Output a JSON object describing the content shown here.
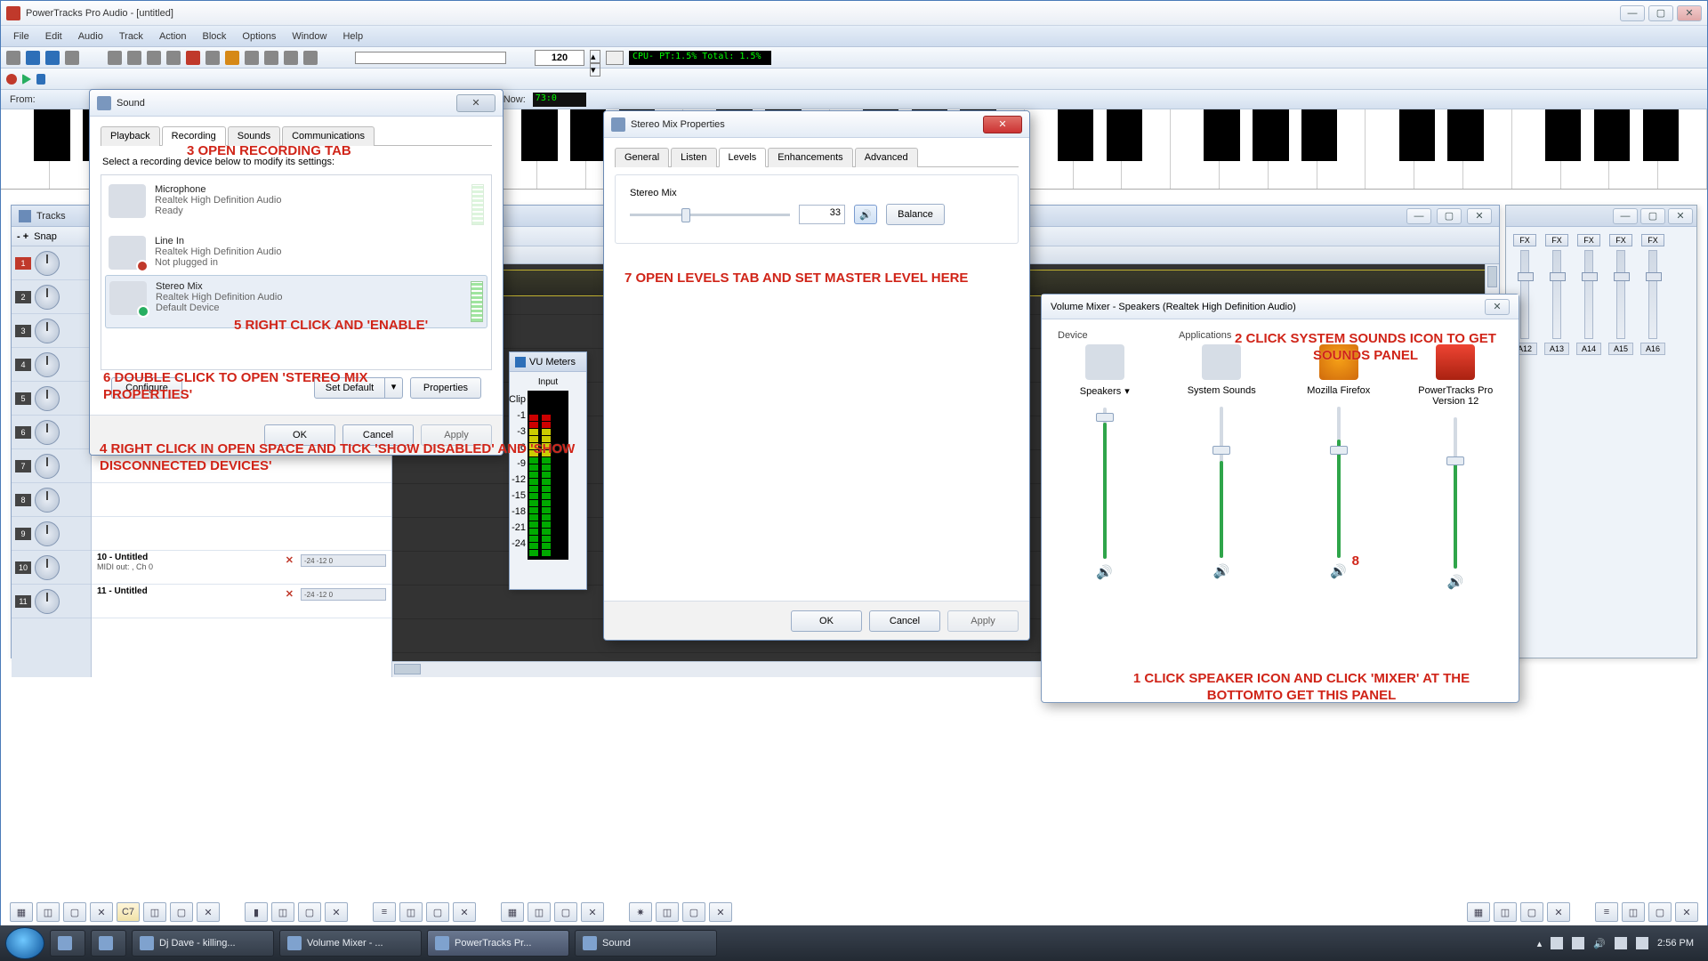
{
  "app": {
    "title": "PowerTracks Pro Audio - [untitled]"
  },
  "menu": [
    "File",
    "Edit",
    "Audio",
    "Track",
    "Action",
    "Block",
    "Options",
    "Window",
    "Help"
  ],
  "tempo": "120",
  "cpu": "CPU- PT:1.5% Total: 1.5%",
  "from_label": "From:",
  "now_label": "Now:",
  "now_time": "73:0",
  "tracks_title": "Tracks",
  "snap_label": "Snap",
  "track_rows": [
    {
      "n": "1"
    },
    {
      "n": "2"
    },
    {
      "n": "3"
    },
    {
      "n": "4"
    },
    {
      "n": "5"
    },
    {
      "n": "6"
    },
    {
      "n": "7"
    },
    {
      "n": "8"
    },
    {
      "n": "9"
    },
    {
      "n": "10",
      "name": "10 - Untitled",
      "sub": "MIDI out: , Ch 0"
    },
    {
      "n": "11",
      "name": "11 - Untitled"
    }
  ],
  "mini_fader_scale": "-24  -12   0",
  "mixer": {
    "fx": "FX",
    "aux": [
      "A12",
      "A13",
      "A14",
      "A15",
      "A16"
    ]
  },
  "bottom_btn": "C7",
  "sound_dlg": {
    "title": "Sound",
    "tabs": [
      "Playback",
      "Recording",
      "Sounds",
      "Communications"
    ],
    "active_tab": "Recording",
    "prompt": "Select a recording device below to modify its settings:",
    "devices": [
      {
        "name": "Microphone",
        "driver": "Realtek High Definition Audio",
        "status": "Ready",
        "badge": "none"
      },
      {
        "name": "Line In",
        "driver": "Realtek High Definition Audio",
        "status": "Not plugged in",
        "badge": "err"
      },
      {
        "name": "Stereo Mix",
        "driver": "Realtek High Definition Audio",
        "status": "Default Device",
        "badge": "ok"
      }
    ],
    "configure": "Configure",
    "set_default": "Set Default",
    "properties": "Properties",
    "ok": "OK",
    "cancel": "Cancel",
    "apply": "Apply"
  },
  "stereo_dlg": {
    "title": "Stereo Mix Properties",
    "tabs": [
      "General",
      "Listen",
      "Levels",
      "Enhancements",
      "Advanced"
    ],
    "active_tab": "Levels",
    "label": "Stereo Mix",
    "value": "33",
    "balance": "Balance",
    "ok": "OK",
    "cancel": "Cancel",
    "apply": "Apply"
  },
  "vu": {
    "title": "VU Meters",
    "sub": "Input",
    "scale": [
      "Clip",
      "-1",
      "-3",
      "-6",
      "-9",
      "-12",
      "-15",
      "-18",
      "-21",
      "-24"
    ]
  },
  "volmix": {
    "title": "Volume Mixer - Speakers (Realtek High Definition Audio)",
    "device_hdr": "Device",
    "apps_hdr": "Applications",
    "cols": [
      {
        "name": "Speakers",
        "drop": true,
        "fill": 90,
        "thumb": 6
      },
      {
        "name": "System Sounds",
        "fill": 64,
        "thumb": 44
      },
      {
        "name": "Mozilla Firefox",
        "fill": 78,
        "thumb": 44
      },
      {
        "name": "PowerTracks Pro Version 12",
        "fill": 72,
        "thumb": 44
      }
    ]
  },
  "notes": {
    "n1": "1 CLICK SPEAKER ICON AND CLICK 'MIXER' AT THE BOTTOMTO GET THIS PANEL",
    "n2": "2 CLICK SYSTEM SOUNDS ICON TO GET SOUNDS PANEL",
    "n3": "3 OPEN RECORDING TAB",
    "n4": "4 RIGHT CLICK IN OPEN SPACE AND TICK 'SHOW DISABLED' AND 'SHOW DISCONNECTED DEVICES'",
    "n5": "5 RIGHT CLICK AND 'ENABLE'",
    "n6": "6 DOUBLE CLICK TO OPEN 'STEREO MIX PROPERTIES'",
    "n7": "7 OPEN LEVELS TAB AND SET MASTER LEVEL  HERE",
    "n8": "8"
  },
  "taskbar": {
    "items": [
      "Dj Dave - killing...",
      "Volume Mixer - ...",
      "PowerTracks Pr...",
      "Sound"
    ],
    "time": "2:56 PM"
  }
}
